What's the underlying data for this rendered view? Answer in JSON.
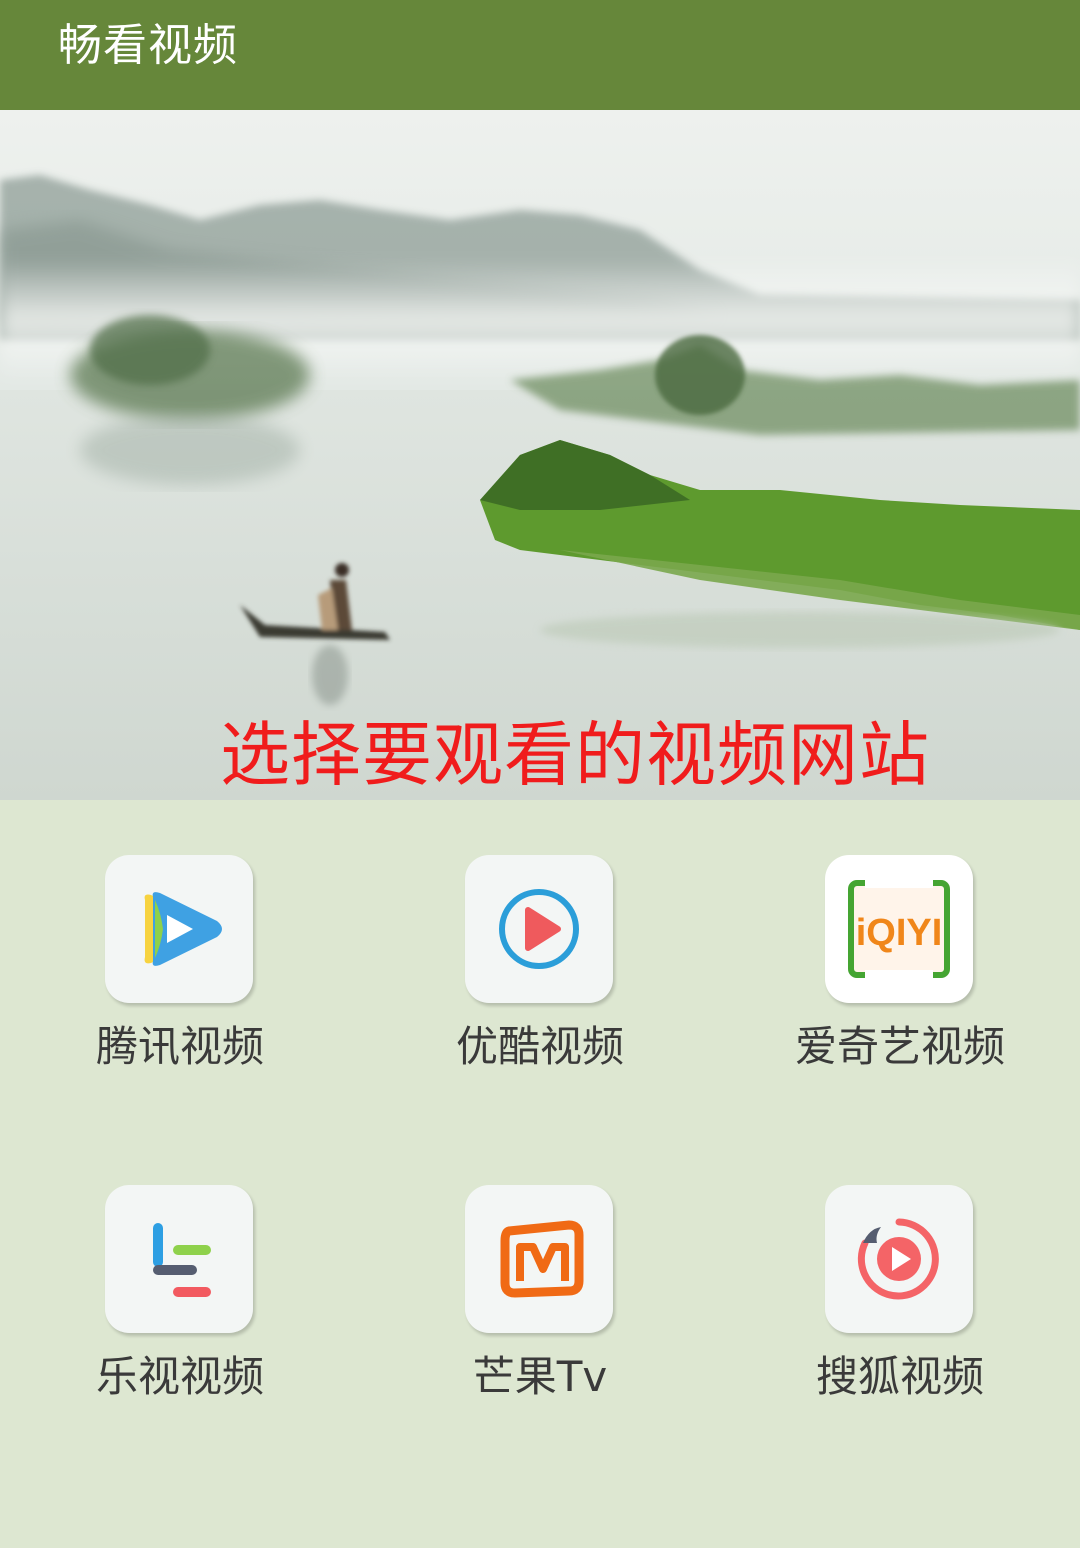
{
  "app_bar": {
    "title": "畅看视频",
    "background": "#66873a"
  },
  "banner": {
    "caption": "选择要观看的视频网站",
    "caption_color": "#f01c1c",
    "image": "misty-lake-fisherman-boat"
  },
  "sites": [
    {
      "label": "腾讯视频",
      "icon": "tencent-video-icon"
    },
    {
      "label": "优酷视频",
      "icon": "youku-icon"
    },
    {
      "label": "爱奇艺视频",
      "icon": "iqiyi-icon",
      "icon_text": "iQIYI"
    },
    {
      "label": "乐视视频",
      "icon": "letv-icon"
    },
    {
      "label": "芒果Tv",
      "icon": "mango-tv-icon"
    },
    {
      "label": "搜狐视频",
      "icon": "sohu-video-icon"
    }
  ],
  "colors": {
    "background": "#dde7d1",
    "tile": "#f3f6f5",
    "label": "#3a3a3a"
  }
}
